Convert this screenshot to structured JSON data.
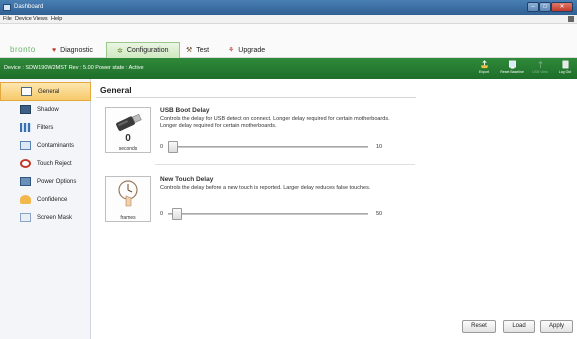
{
  "window": {
    "title": "Dashboard"
  },
  "menu": {
    "items": [
      "File",
      "Device",
      "Views",
      "Help"
    ]
  },
  "brand": "bronto",
  "tabs": [
    {
      "label": "Diagnostic",
      "icon": "heart-icon",
      "color": "#c0392b",
      "active": false
    },
    {
      "label": "Configuration",
      "icon": "gear-icon",
      "color": "#6a8a2a",
      "active": true
    },
    {
      "label": "Test",
      "icon": "hammer-icon",
      "color": "#6b4a2a",
      "active": false
    },
    {
      "label": "Upgrade",
      "icon": "upgrade-icon",
      "color": "#b83a2a",
      "active": false
    }
  ],
  "status": {
    "text": "Device : SDW190W2MST Rev : 5.00  Power state : Active"
  },
  "toolbar": {
    "export_label": "Export",
    "reset_baseline_label": "Reset Baseline",
    "usb_view_label": "USB View",
    "log_out_label": "Log Out"
  },
  "sidebar": {
    "items": [
      {
        "label": "General",
        "icon": "general-icon",
        "active": true
      },
      {
        "label": "Shadow",
        "icon": "shadow-icon",
        "active": false
      },
      {
        "label": "Filters",
        "icon": "filters-icon",
        "active": false
      },
      {
        "label": "Contaminants",
        "icon": "contaminants-icon",
        "active": false
      },
      {
        "label": "Touch Reject",
        "icon": "touch-reject-icon",
        "active": false
      },
      {
        "label": "Power Options",
        "icon": "power-options-icon",
        "active": false
      },
      {
        "label": "Confidence",
        "icon": "confidence-icon",
        "active": false
      },
      {
        "label": "Screen Mask",
        "icon": "screen-mask-icon",
        "active": false
      }
    ]
  },
  "main": {
    "title": "General",
    "settings": [
      {
        "title": "USB Boot Delay",
        "description": "Controls the delay for USB detect on connect.  Longer delay required for certain motherboards. Longer delay required for certain motherboards.",
        "icon": "usb-icon",
        "icon_value": "0",
        "icon_unit": "seconds",
        "min": "0",
        "max": "10",
        "value": 0
      },
      {
        "title": "New Touch Delay",
        "description": "Controls the delay before a new touch is reported.  Larger delay reduces false touches.",
        "icon": "touch-hand-icon",
        "icon_unit": "frames",
        "min": "0",
        "max": "50",
        "value": 1
      }
    ]
  },
  "buttons": {
    "reset": "Reset",
    "load": "Load",
    "apply": "Apply"
  },
  "colors": {
    "status_bar": "#1e6e29",
    "active_sidebar": "#f7c96a",
    "title_bar": "#2f5f93"
  }
}
